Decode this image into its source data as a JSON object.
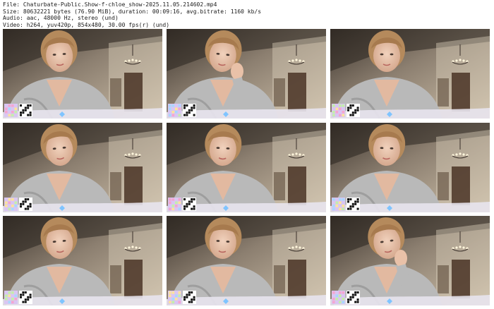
{
  "header": {
    "file_line": "File: Chaturbate-Public.Show-f-chloe_show-2025.11.05.214602.mp4",
    "size_line": "Size: 80632221 bytes (76.90 MiB), duration: 00:09:16, avg.bitrate: 1160 kb/s",
    "audio_line": "Audio: aac, 48000 Hz, stereo (und)",
    "video_line": "Video: h264, yuv420p, 854x480, 30.00 fps(r) (und)"
  },
  "thumbnails": [
    {
      "row": 1,
      "col": 1,
      "head_tilt": -4,
      "hand_to_face": false
    },
    {
      "row": 1,
      "col": 2,
      "head_tilt": 6,
      "hand_to_face": true
    },
    {
      "row": 1,
      "col": 3,
      "head_tilt": 0,
      "hand_to_face": false
    },
    {
      "row": 2,
      "col": 1,
      "head_tilt": -6,
      "hand_to_face": false
    },
    {
      "row": 2,
      "col": 2,
      "head_tilt": 3,
      "hand_to_face": false
    },
    {
      "row": 2,
      "col": 3,
      "head_tilt": 2,
      "hand_to_face": false
    },
    {
      "row": 3,
      "col": 1,
      "head_tilt": -5,
      "hand_to_face": false
    },
    {
      "row": 3,
      "col": 2,
      "head_tilt": 4,
      "hand_to_face": false
    },
    {
      "row": 3,
      "col": 3,
      "head_tilt": -8,
      "hand_to_face": true
    }
  ]
}
